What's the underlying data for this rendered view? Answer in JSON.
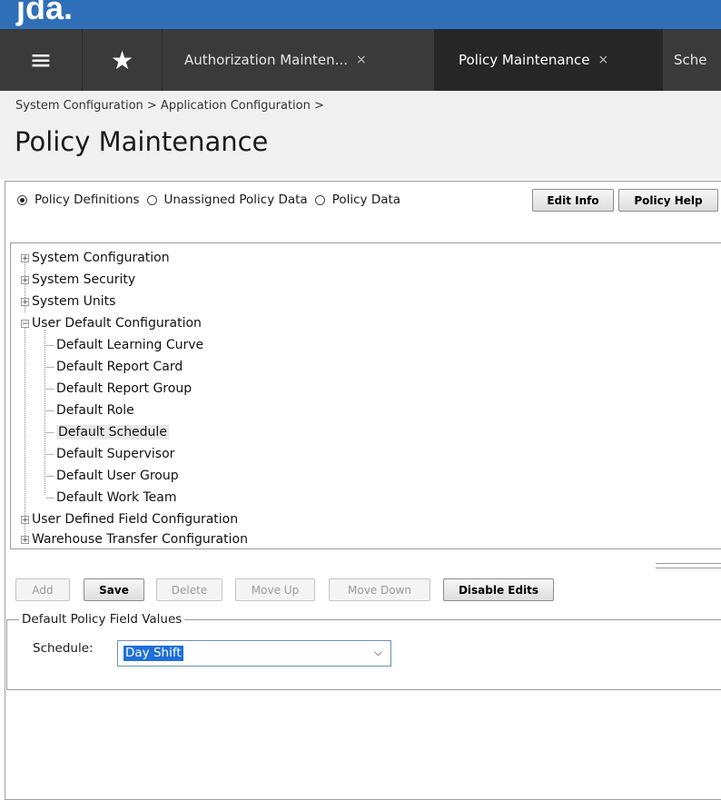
{
  "brand": {
    "logo_text": "jda."
  },
  "tabbar": {
    "menu_icon": "hamburger-menu-icon",
    "favorites_icon": "star-icon",
    "tabs": [
      {
        "label": "Authorization Mainten...",
        "close": "×"
      },
      {
        "label": "Policy Maintenance",
        "close": "×"
      },
      {
        "label": "Sche"
      }
    ]
  },
  "header": {
    "breadcrumb": "System Configuration > Application Configuration >",
    "title": "Policy Maintenance"
  },
  "radios": {
    "options": [
      {
        "label": "Policy Definitions",
        "selected": true
      },
      {
        "label": "Unassigned Policy Data",
        "selected": false
      },
      {
        "label": "Policy Data",
        "selected": false
      }
    ],
    "edit_info": "Edit Info",
    "policy_help": "Policy Help"
  },
  "tree": {
    "items": [
      {
        "label": "System Configuration",
        "expander": "+"
      },
      {
        "label": "System Security",
        "expander": "+"
      },
      {
        "label": "System Units",
        "expander": "+"
      },
      {
        "label": "User Default Configuration",
        "expander": "−"
      },
      {
        "label": "Default Learning Curve"
      },
      {
        "label": "Default Report Card"
      },
      {
        "label": "Default Report Group"
      },
      {
        "label": "Default Role"
      },
      {
        "label": "Default Schedule",
        "selected": true
      },
      {
        "label": "Default Supervisor"
      },
      {
        "label": "Default User Group"
      },
      {
        "label": "Default Work Team"
      },
      {
        "label": "User Defined Field Configuration",
        "expander": "+"
      },
      {
        "label": "Warehouse Transfer Configuration",
        "expander": "+"
      }
    ]
  },
  "actions": {
    "add": "Add",
    "save": "Save",
    "delete": "Delete",
    "move_up": "Move Up",
    "move_down": "Move Down",
    "disable_edits": "Disable Edits"
  },
  "fields": {
    "legend": "Default Policy Field Values",
    "schedule_label": "Schedule:",
    "schedule_value": "Day Shift"
  },
  "colors": {
    "brand_blue": "#2f6fb8",
    "tabbar_dark": "#3a3a3a",
    "selection_blue": "#1e6fd9"
  }
}
